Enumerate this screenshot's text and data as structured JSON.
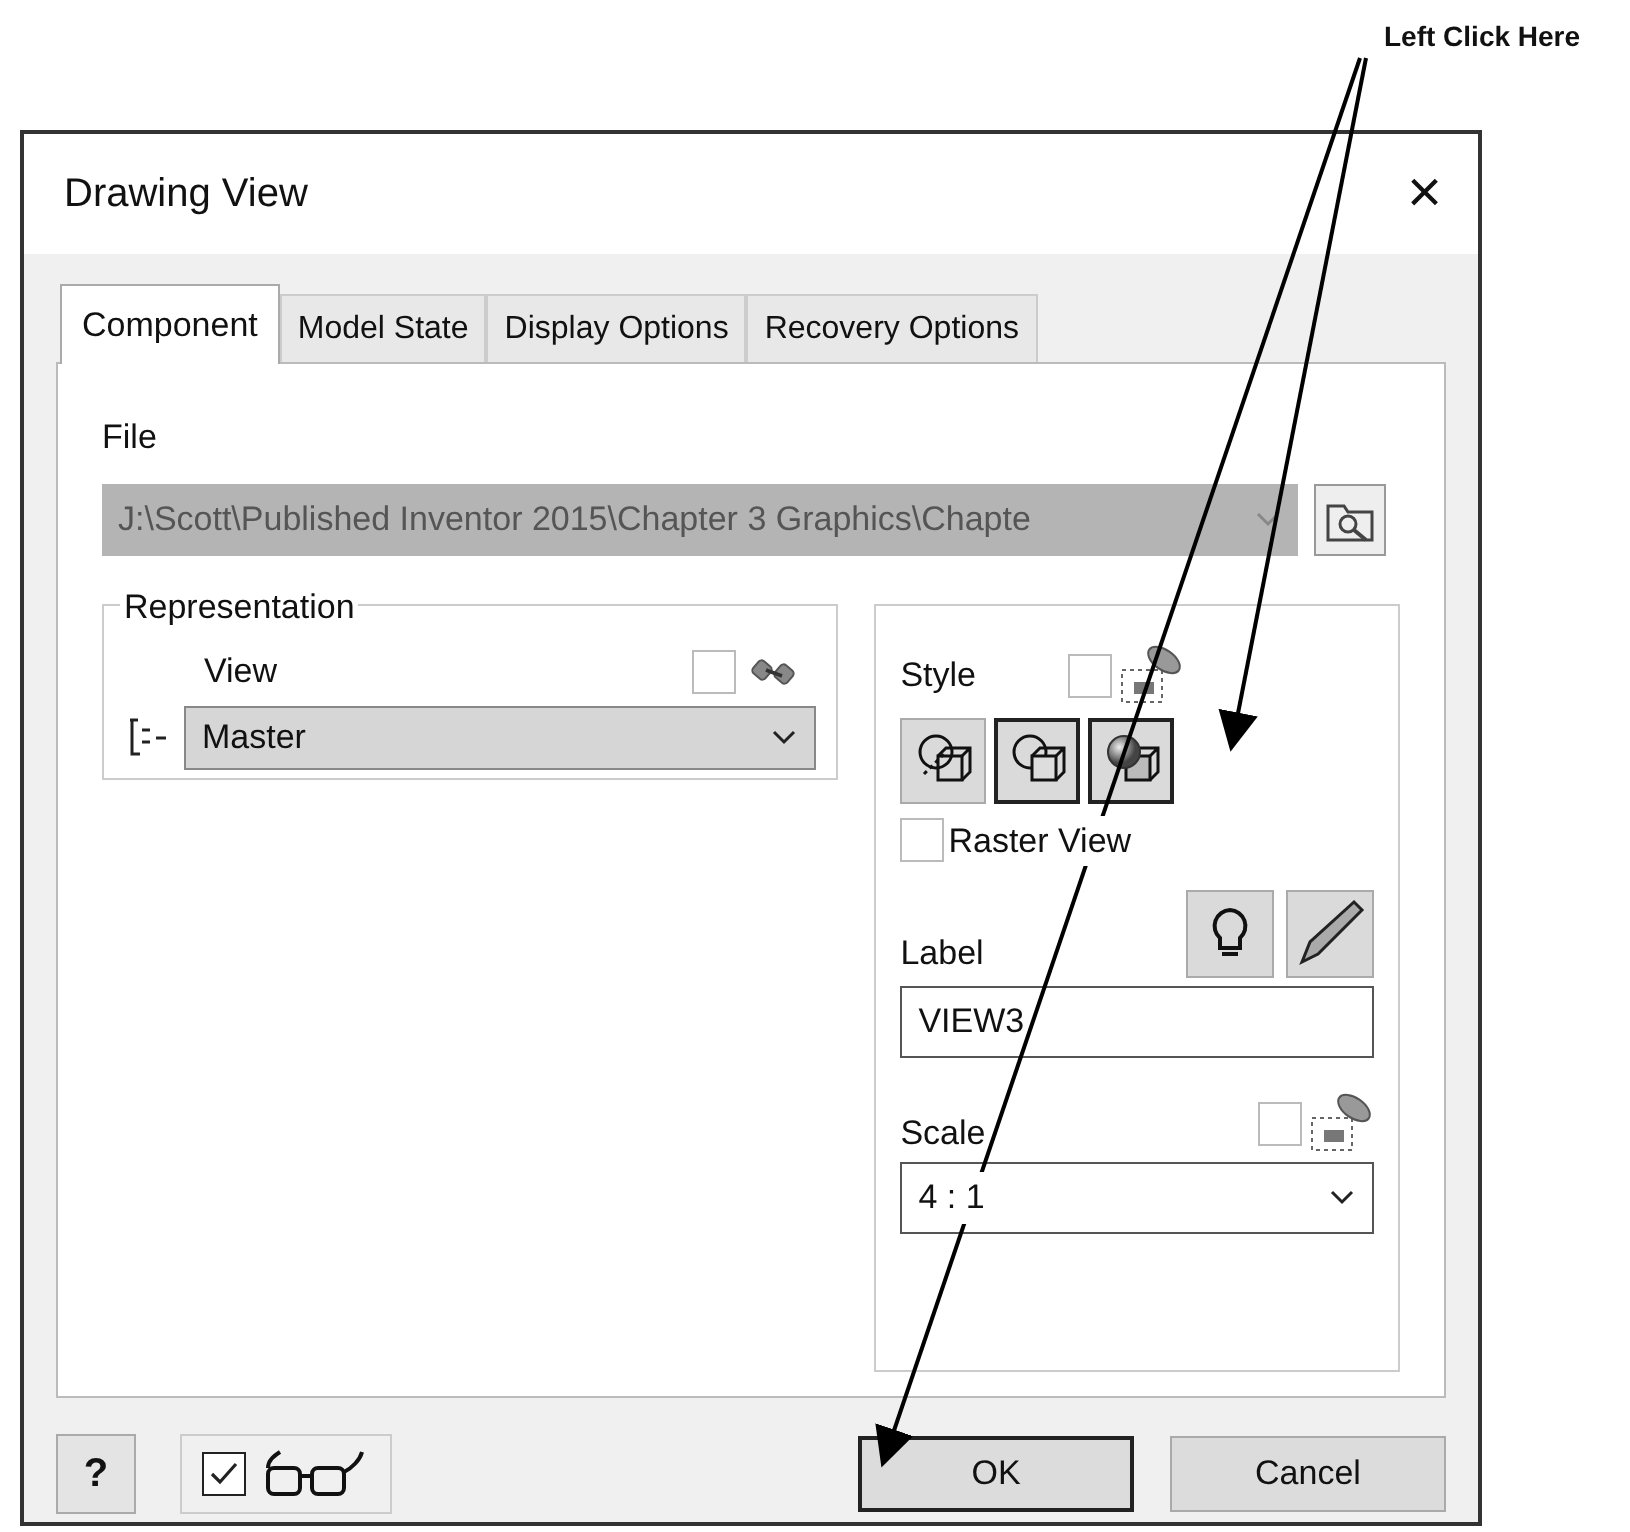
{
  "annotation": {
    "text": "Left Click Here"
  },
  "window": {
    "title": "Drawing View",
    "close": "×"
  },
  "tabs": [
    {
      "label": "Component",
      "selected": true
    },
    {
      "label": "Model State",
      "selected": false
    },
    {
      "label": "Display Options",
      "selected": false
    },
    {
      "label": "Recovery Options",
      "selected": false
    }
  ],
  "file": {
    "label": "File",
    "value": "J:\\Scott\\Published Inventor 2015\\Chapter 3 Graphics\\Chapte",
    "disabled": true
  },
  "representation": {
    "title": "Representation",
    "view_label": "View",
    "associative_checked": false,
    "value": "Master",
    "disabled": true
  },
  "style": {
    "label": "Style",
    "associative_checked": false,
    "buttons": [
      {
        "kind": "hidden",
        "selected": false
      },
      {
        "kind": "removed",
        "selected": true
      },
      {
        "kind": "shaded",
        "selected": true
      }
    ],
    "raster_view": {
      "label": "Raster View",
      "checked": false
    }
  },
  "label": {
    "label": "Label",
    "value": "VIEW3"
  },
  "scale": {
    "label": "Scale",
    "associative_checked": false,
    "value": "4 : 1"
  },
  "footer": {
    "help": "?",
    "preview_checked": true,
    "buttons": [
      {
        "label": "OK",
        "default": true
      },
      {
        "label": "Cancel",
        "default": false
      }
    ]
  }
}
